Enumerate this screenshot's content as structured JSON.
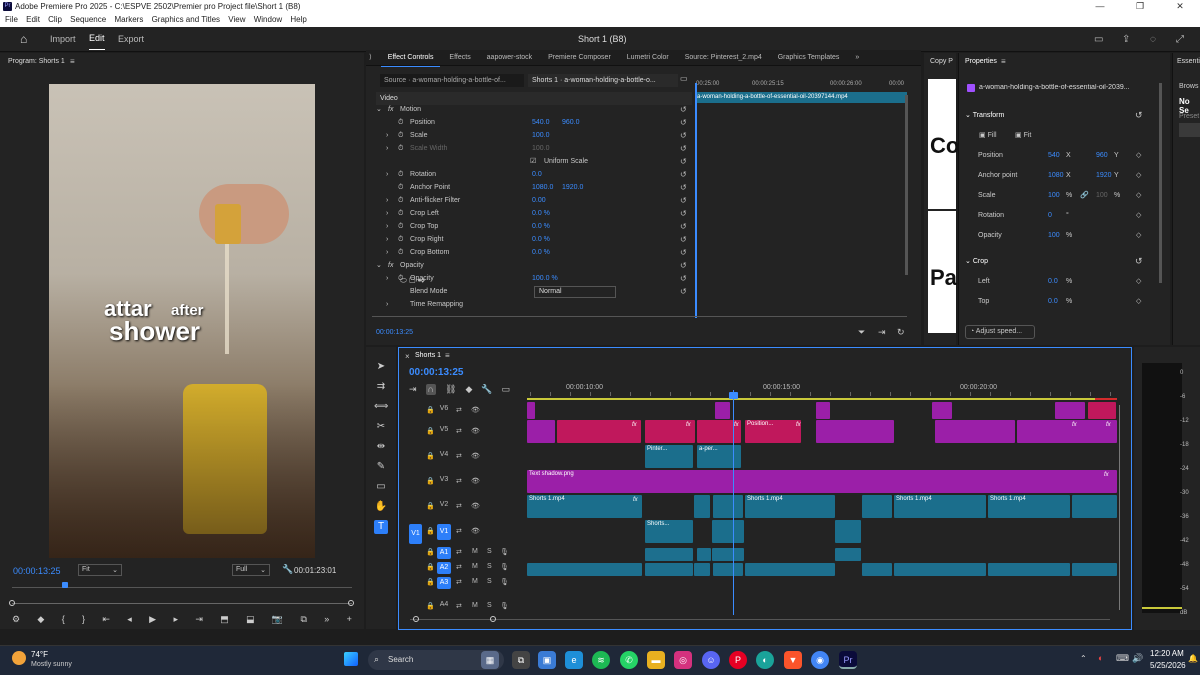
{
  "window": {
    "title": "Adobe Premiere Pro 2025 - C:\\ESPVE 2502\\Premier pro Project file\\Short 1 (B8)",
    "app_icon": "Pr"
  },
  "menu": [
    "File",
    "Edit",
    "Clip",
    "Sequence",
    "Markers",
    "Graphics and Titles",
    "View",
    "Window",
    "Help"
  ],
  "header": {
    "import": "Import",
    "edit": "Edit",
    "export": "Export",
    "project_title": "Short 1 (B8)"
  },
  "program": {
    "title": "Program: Shorts 1",
    "overlay_line1_a": "attar",
    "overlay_line1_b": "after",
    "overlay_line2": "shower",
    "timecode": "00:00:13:25",
    "fit": "Fit",
    "quality": "Full",
    "duration": "00:01:23:01"
  },
  "panel_tabs": [
    "Effect Controls",
    "Effects",
    "aapower-stock",
    "Premiere Composer",
    "Lumetri Color",
    "Source: Pinterest_2.mp4",
    "Graphics Templates"
  ],
  "effect_controls": {
    "source_tab": "Source · a-woman-holding-a-bottle-of...",
    "seq_tab": "Shorts 1 · a-woman-holding-a-bottle-o...",
    "mini_ruler": [
      "00:25:00",
      "00:00:25:15",
      "00:00:26:00",
      "00:00"
    ],
    "clip_label": "a-woman-holding-a-bottle-of-essential-oil-20397144.mp4",
    "section": "Video",
    "rows": [
      {
        "label": "Motion",
        "v1": "",
        "v2": ""
      },
      {
        "label": "Position",
        "v1": "540.0",
        "v2": "960.0"
      },
      {
        "label": "Scale",
        "v1": "100.0",
        "v2": ""
      },
      {
        "label": "Scale Width",
        "v1": "100.0",
        "v2": ""
      },
      {
        "label": "Uniform Scale",
        "v1": "",
        "v2": ""
      },
      {
        "label": "Rotation",
        "v1": "0.0",
        "v2": ""
      },
      {
        "label": "Anchor Point",
        "v1": "1080.0",
        "v2": "1920.0"
      },
      {
        "label": "Anti-flicker Filter",
        "v1": "0.00",
        "v2": ""
      },
      {
        "label": "Crop Left",
        "v1": "0.0 %",
        "v2": ""
      },
      {
        "label": "Crop Top",
        "v1": "0.0 %",
        "v2": ""
      },
      {
        "label": "Crop Right",
        "v1": "0.0 %",
        "v2": ""
      },
      {
        "label": "Crop Bottom",
        "v1": "0.0 %",
        "v2": ""
      },
      {
        "label": "Opacity",
        "v1": "",
        "v2": ""
      },
      {
        "label": "Opacity",
        "v1": "100.0 %",
        "v2": ""
      },
      {
        "label": "Blend Mode",
        "v1": "Normal",
        "v2": ""
      },
      {
        "label": "Time Remapping",
        "v1": "",
        "v2": ""
      }
    ],
    "timecode": "00:00:13:25"
  },
  "copy_panel": {
    "title": "Copy P",
    "text1": "Co",
    "text2": "Pa"
  },
  "properties": {
    "title": "Properties",
    "clip_name": "a-woman-holding-a-bottle-of-essential-oil-2039...",
    "transform": "Transform",
    "fill": "Fill",
    "fit": "Fit",
    "rows": [
      {
        "label": "Position",
        "v1": "540",
        "u1": "X",
        "v2": "960",
        "u2": "Y"
      },
      {
        "label": "Anchor point",
        "v1": "1080",
        "u1": "X",
        "v2": "1920",
        "u2": "Y"
      },
      {
        "label": "Scale",
        "v1": "100",
        "u1": "%",
        "v2": "100",
        "u2": "%"
      },
      {
        "label": "Rotation",
        "v1": "0",
        "u1": "°",
        "v2": "",
        "u2": ""
      },
      {
        "label": "Opacity",
        "v1": "100",
        "u1": "%",
        "v2": "",
        "u2": ""
      }
    ],
    "crop": "Crop",
    "crop_rows": [
      {
        "label": "Left",
        "v1": "0.0",
        "u1": "%"
      },
      {
        "label": "Top",
        "v1": "0.0",
        "u1": "%"
      }
    ],
    "adjust": "Adjust speed..."
  },
  "essentials": {
    "title": "Essenti",
    "brows": "Brows",
    "nose": "No Se",
    "preset": "Preset"
  },
  "timeline": {
    "title": "Shorts 1",
    "timecode": "00:00:13:25",
    "ruler": [
      "00:00:10:00",
      "00:00:15:00",
      "00:00:20:00"
    ],
    "tracks": [
      "V6",
      "V5",
      "V4",
      "V3",
      "V2",
      "V1",
      "A1",
      "A2",
      "A3",
      "A4"
    ],
    "src_v1": "V1",
    "clips": {
      "position": "Position...",
      "pinterest": "Pinter...",
      "aper": "a-per...",
      "text_shadow": "Text shadow.png",
      "shorts": "Shorts 1.mp4",
      "shorts_short": "Shorts..."
    }
  },
  "meter_labels": [
    "0",
    "-6",
    "-12",
    "-18",
    "-24",
    "-30",
    "-36",
    "-42",
    "-48",
    "-54",
    "dB"
  ],
  "taskbar": {
    "temp": "74°F",
    "weather": "Mostly sunny",
    "search": "Search",
    "time": "12:20 AM",
    "date": "5/25/2026"
  }
}
